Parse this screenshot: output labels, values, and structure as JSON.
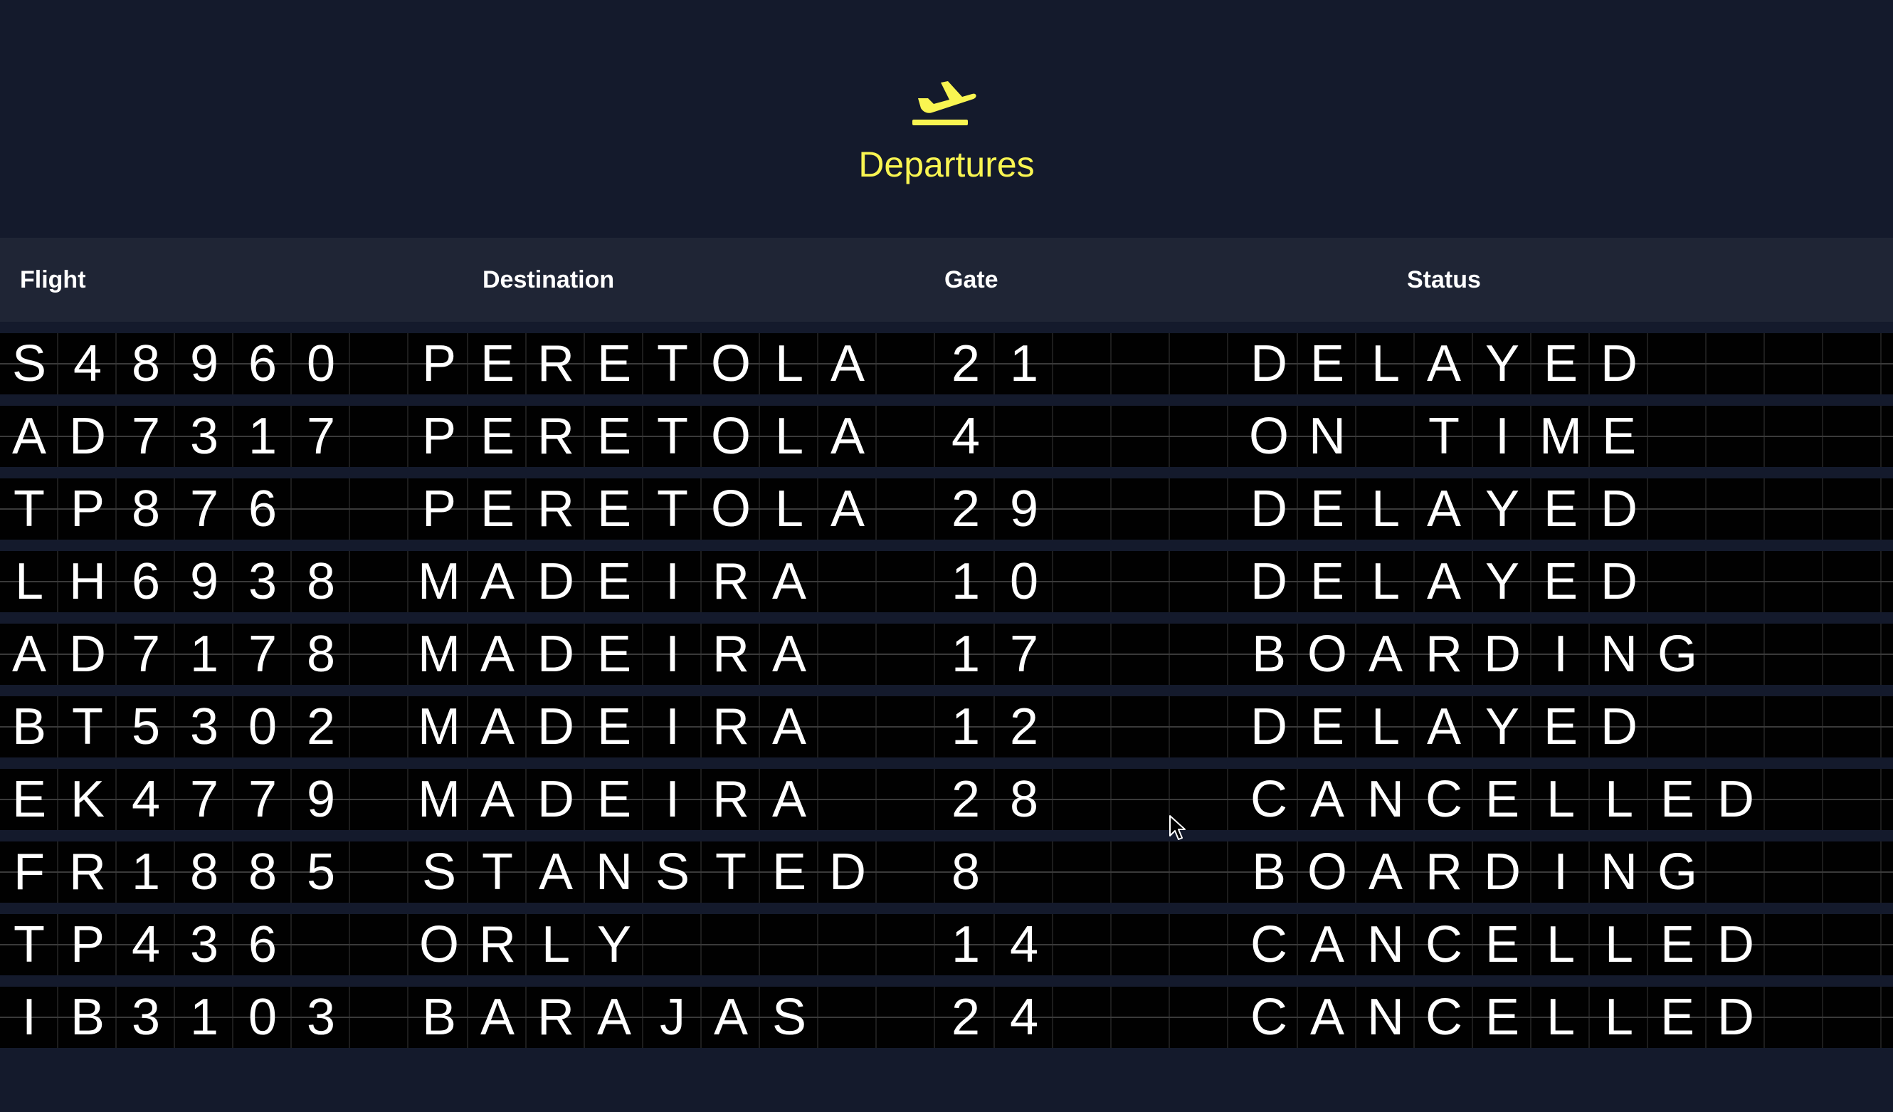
{
  "header": {
    "icon": "airplane-departure-icon",
    "title": "Departures",
    "accent_color": "#f9f551"
  },
  "columns": {
    "flight": "Flight",
    "destination": "Destination",
    "gate": "Gate",
    "status": "Status"
  },
  "rows": [
    {
      "flight": "S48960",
      "destination": "PERETOLA",
      "gate": "21",
      "status": "DELAYED"
    },
    {
      "flight": "AD7317",
      "destination": "PERETOLA",
      "gate": "4",
      "status": "ON TIME"
    },
    {
      "flight": "TP876",
      "destination": "PERETOLA",
      "gate": "29",
      "status": "DELAYED"
    },
    {
      "flight": "LH6938",
      "destination": "MADEIRA",
      "gate": "10",
      "status": "DELAYED"
    },
    {
      "flight": "AD7178",
      "destination": "MADEIRA",
      "gate": "17",
      "status": "BOARDING"
    },
    {
      "flight": "BT5302",
      "destination": "MADEIRA",
      "gate": "12",
      "status": "DELAYED"
    },
    {
      "flight": "EK4779",
      "destination": "MADEIRA",
      "gate": "28",
      "status": "CANCELLED"
    },
    {
      "flight": "FR1885",
      "destination": "STANSTED",
      "gate": "8",
      "status": "BOARDING"
    },
    {
      "flight": "TP436",
      "destination": "ORLY",
      "gate": "14",
      "status": "CANCELLED"
    },
    {
      "flight": "IB3103",
      "destination": "BARAJAS",
      "gate": "24",
      "status": "CANCELLED"
    }
  ]
}
